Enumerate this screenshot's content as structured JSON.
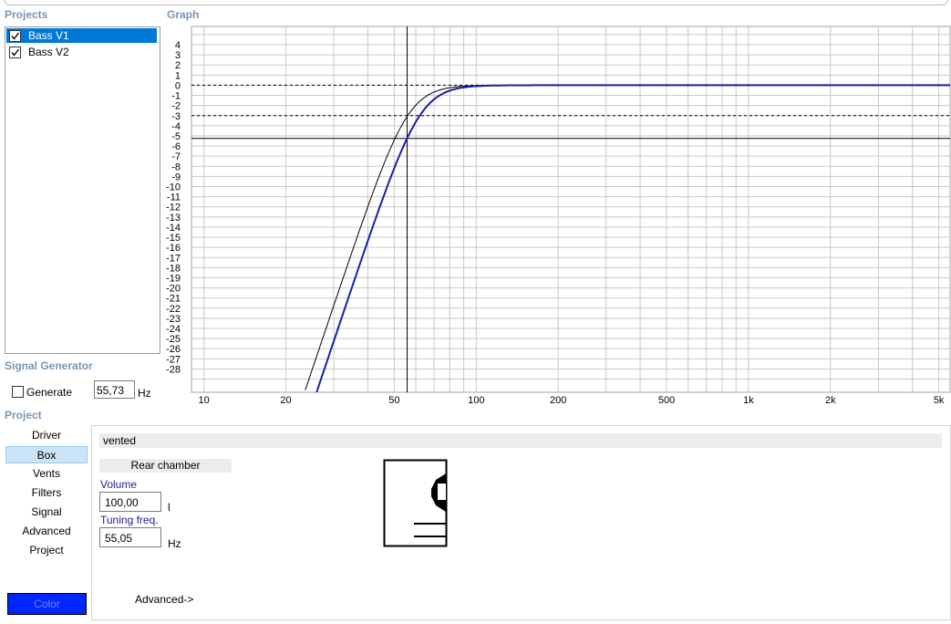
{
  "sections": {
    "projects": "Projects",
    "graph": "Graph",
    "signal_generator": "Signal Generator",
    "project": "Project"
  },
  "projects": [
    {
      "label": "Bass V1",
      "checked": true,
      "selected": true
    },
    {
      "label": "Bass V2",
      "checked": true,
      "selected": false
    }
  ],
  "signal": {
    "generate_label": "Generate",
    "generate_checked": false,
    "frequency": "55,73",
    "unit": "Hz"
  },
  "graph": {
    "y_ticks": [
      "4",
      "3",
      "2",
      "1",
      "0",
      "-1",
      "-2",
      "-3",
      "-4",
      "-5",
      "-6",
      "-7",
      "-8",
      "-9",
      "-10",
      "-11",
      "-12",
      "-13",
      "-14",
      "-15",
      "-16",
      "-17",
      "-18",
      "-19",
      "-20",
      "-21",
      "-22",
      "-23",
      "-24",
      "-25",
      "-26",
      "-27",
      "-28"
    ],
    "x_ticks": [
      "10",
      "20",
      "50",
      "100",
      "200",
      "500",
      "1k",
      "2k",
      "5k"
    ],
    "cursor_freq_hz": 55.73,
    "ref_lines_db": [
      0,
      -3
    ],
    "series_colors": {
      "v1": "#000000",
      "v2": "#1b1fa8"
    }
  },
  "nav": {
    "items": [
      "Driver",
      "Box",
      "Vents",
      "Filters",
      "Signal",
      "Advanced",
      "Project"
    ],
    "selected_index": 1,
    "color_button": "Color",
    "color_hex": "#0026ff"
  },
  "box": {
    "type": "vented",
    "rear_chamber": "Rear chamber",
    "volume_label": "Volume",
    "volume_value": "100,00",
    "volume_unit": "l",
    "tuning_label": "Tuning freq.",
    "tuning_value": "55,05",
    "tuning_unit": "Hz",
    "advanced_link": "Advanced->"
  }
}
